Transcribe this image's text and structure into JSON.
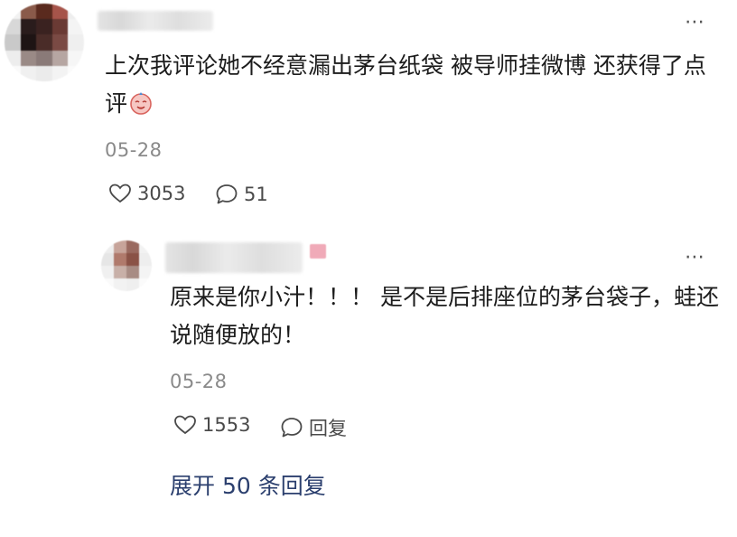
{
  "comment": {
    "author_avatar_colors": [
      "#f2f2f2",
      "#8a5a4a",
      "#5a2a1e",
      "#a6544a",
      "#eeeeee",
      "#d8d8d8",
      "#2a1c1c",
      "#3a2220",
      "#6a3a34",
      "#f4f4f4",
      "#c9c9c9",
      "#1e1414",
      "#4a2c28",
      "#7a4a44",
      "#efefef",
      "#ededed",
      "#9a8a86",
      "#8a7a78",
      "#b6a6a2",
      "#f6f6f6",
      "#fafafa",
      "#f0f0f0",
      "#ebebeb",
      "#f3f3f3",
      "#fbfbfb"
    ],
    "text": "上次我评论她不经意漏出茅台纸袋 被导师挂微博 还获得了点评",
    "date": "05-28",
    "likes": "3053",
    "replies": "51",
    "more_icon": "⋯"
  },
  "reply": {
    "author_avatar_colors": [
      "#eeeeee",
      "#c7a49a",
      "#9a6a60",
      "#f2f2f2",
      "#e6e6e6",
      "#b07a6c",
      "#8a5246",
      "#eeeeee",
      "#f0f0f0",
      "#c8b0a8",
      "#a88c84",
      "#f4f4f4",
      "#fafafa",
      "#f2f2f2",
      "#efefef",
      "#fbfbfb"
    ],
    "text": "原来是你小汁！！！ 是不是后排座位的茅台袋子，蛙还说随便放的！",
    "date": "05-28",
    "likes": "1553",
    "reply_label": "回复",
    "more_icon": "⋯"
  },
  "expand_label": "展开 50 条回复",
  "colors": {
    "link": "#2b3f6e",
    "meta": "#8a8a8a",
    "pink_badge": "#f0aab8"
  }
}
